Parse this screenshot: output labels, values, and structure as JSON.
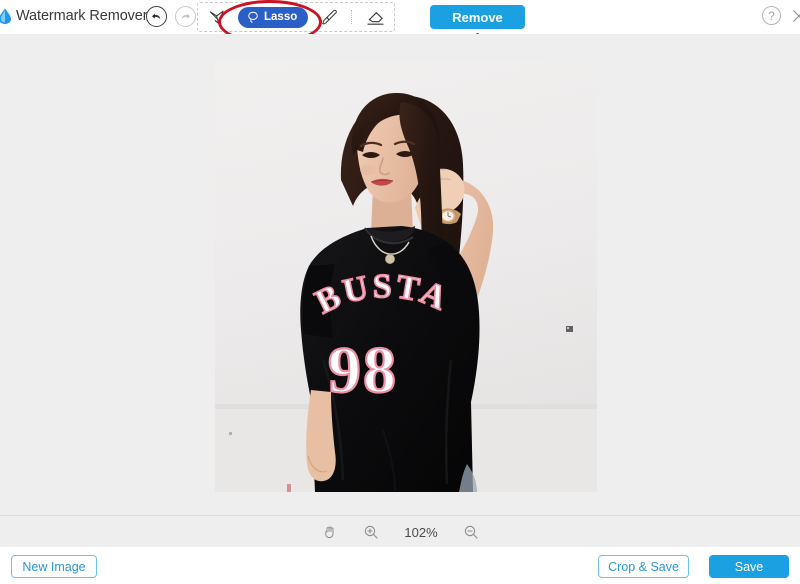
{
  "app": {
    "title": "Watermark Remover",
    "logo_icon": "water-drop-logo"
  },
  "toolbar": {
    "undo_icon": "undo-arrow-icon",
    "redo_icon": "redo-arrow-icon",
    "tools": [
      {
        "id": "magic-wand",
        "icon": "magic-wand-icon",
        "label": "",
        "active": false
      },
      {
        "id": "lasso",
        "icon": "lasso-icon",
        "label": "Lasso",
        "active": true
      },
      {
        "id": "brush",
        "icon": "brush-icon",
        "label": "",
        "active": false
      },
      {
        "id": "eraser",
        "icon": "eraser-icon",
        "label": "",
        "active": false
      }
    ],
    "remove_label": "Remove",
    "help_icon": "question-mark-icon",
    "help_label": "?",
    "close_icon": "close-x-icon"
  },
  "annotations": {
    "ellipse_target": "Lasso",
    "arrow_target": "Remove",
    "color": "#cc1122"
  },
  "canvas": {
    "image_alt": "woman-in-black-busta-98-tshirt",
    "shirt_text_top": "BUSTA",
    "shirt_text_bottom": "98"
  },
  "zoombar": {
    "pan_icon": "hand-pan-icon",
    "zoom_in_icon": "zoom-in-icon",
    "zoom_level": "102%",
    "zoom_out_icon": "zoom-out-icon"
  },
  "bottombar": {
    "new_image_label": "New Image",
    "crop_save_label": "Crop & Save",
    "save_label": "Save"
  },
  "colors": {
    "accent_blue": "#1ba1e2",
    "lasso_blue": "#2a5fc8",
    "outline_blue": "#6cc2ef",
    "annotation_red": "#cc1122",
    "canvas_bg": "#eeeeef"
  }
}
